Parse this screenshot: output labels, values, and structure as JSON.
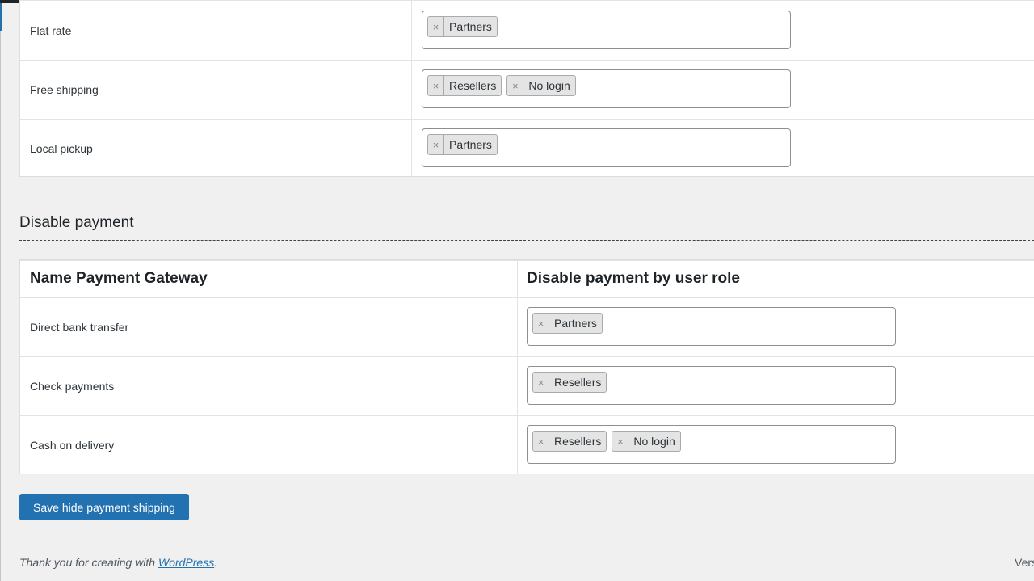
{
  "shipping_rows": [
    {
      "name": "Flat rate",
      "roles": [
        "Partners"
      ]
    },
    {
      "name": "Free shipping",
      "roles": [
        "Resellers",
        "No login"
      ]
    },
    {
      "name": "Local pickup",
      "roles": [
        "Partners"
      ]
    }
  ],
  "payment_section": {
    "title": "Disable payment",
    "col_name_header": "Name Payment Gateway",
    "col_role_header": "Disable payment by user role",
    "rows": [
      {
        "name": "Direct bank transfer",
        "roles": [
          "Partners"
        ]
      },
      {
        "name": "Check payments",
        "roles": [
          "Resellers"
        ]
      },
      {
        "name": "Cash on delivery",
        "roles": [
          "Resellers",
          "No login"
        ]
      }
    ]
  },
  "chip_remove_glyph": "×",
  "save_button_label": "Save hide payment shipping",
  "footer": {
    "prefix": "Thank you for creating with ",
    "link_text": "WordPress",
    "suffix": "."
  },
  "version_text": "Vers",
  "colors": {
    "accent": "#2271b1",
    "background": "#f0f0f1"
  }
}
